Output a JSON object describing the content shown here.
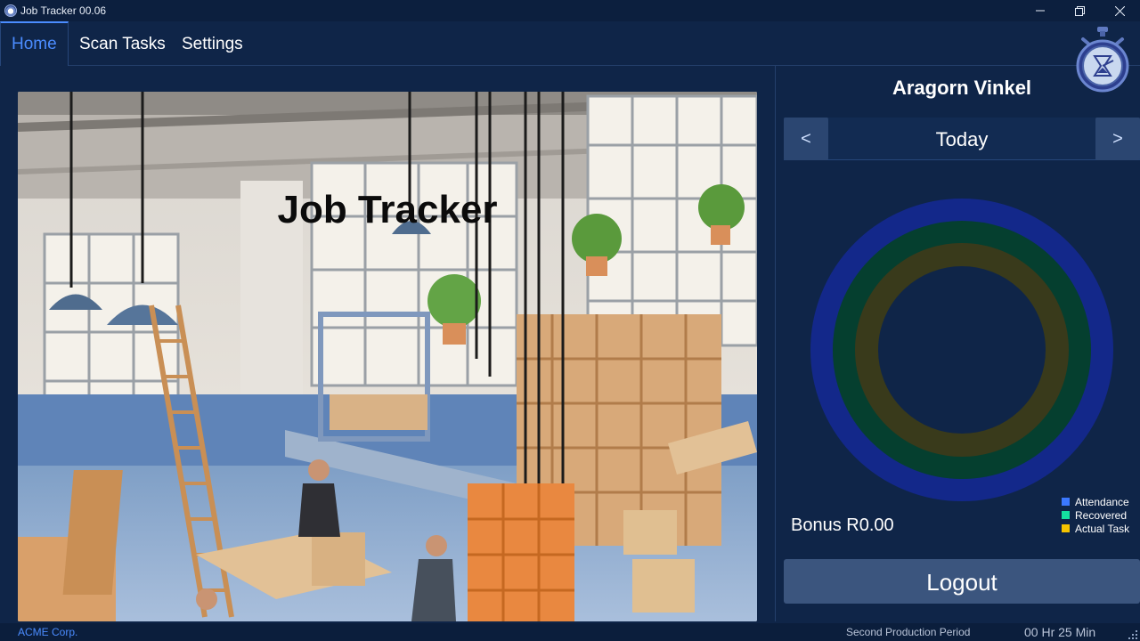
{
  "window": {
    "title": "Job Tracker 00.06",
    "controls": {
      "minimize": "—",
      "restore": "❐",
      "close": "✕"
    }
  },
  "nav": {
    "tabs": [
      {
        "label": "Home",
        "active": true
      },
      {
        "label": "Scan Tasks",
        "active": false
      },
      {
        "label": "Settings",
        "active": false
      }
    ]
  },
  "hero": {
    "title": "Job Tracker"
  },
  "panel": {
    "user_name": "Aragorn Vinkel",
    "date": {
      "prev": "<",
      "label": "Today",
      "next": ">"
    },
    "rings": {
      "attendance": {
        "color": "#13288a"
      },
      "recovered": {
        "color": "#053f2f"
      },
      "actual_task": {
        "color": "#393a1b"
      }
    },
    "legend": [
      {
        "label": "Attendance",
        "color": "#3b78ff"
      },
      {
        "label": "Recovered",
        "color": "#14e0a0"
      },
      {
        "label": "Actual Task",
        "color": "#f5c400"
      }
    ],
    "bonus": "Bonus R0.00",
    "logout": "Logout"
  },
  "status": {
    "company": "ACME Corp.",
    "period": "Second Production Period",
    "time": "00 Hr 25 Min"
  }
}
